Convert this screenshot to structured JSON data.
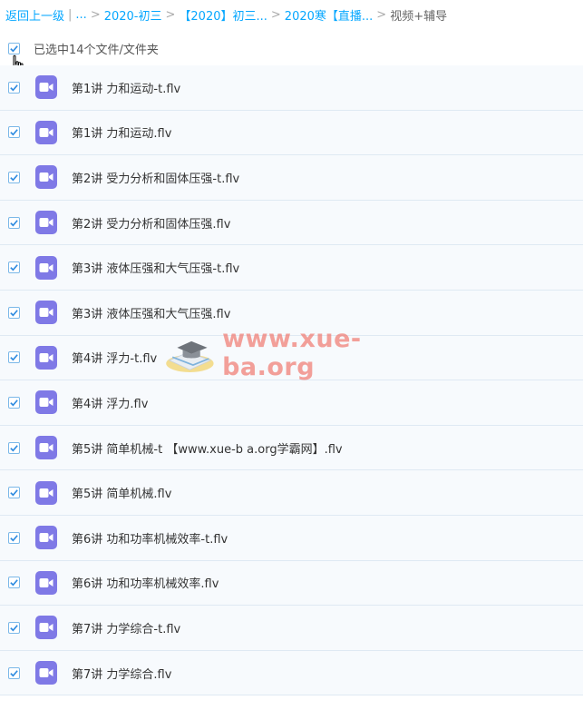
{
  "breadcrumb": {
    "back": "返回上一级",
    "ellipsis": "...",
    "items": [
      "2020-初三",
      "【2020】初三...",
      "2020寒【直播..."
    ],
    "current": "视频+辅导"
  },
  "selection": {
    "label": "已选中14个文件/文件夹"
  },
  "files": [
    {
      "name": "第1讲 力和运动-t.flv",
      "checked": true
    },
    {
      "name": "第1讲 力和运动.flv",
      "checked": true
    },
    {
      "name": "第2讲 受力分析和固体压强-t.flv",
      "checked": true
    },
    {
      "name": "第2讲 受力分析和固体压强.flv",
      "checked": true
    },
    {
      "name": "第3讲 液体压强和大气压强-t.flv",
      "checked": true
    },
    {
      "name": "第3讲 液体压强和大气压强.flv",
      "checked": true
    },
    {
      "name": "第4讲 浮力-t.flv",
      "checked": true
    },
    {
      "name": "第4讲 浮力.flv",
      "checked": true
    },
    {
      "name": "第5讲 简单机械-t 【www.xue-b a.org学霸网】.flv",
      "checked": true
    },
    {
      "name": "第5讲 简单机械.flv",
      "checked": true
    },
    {
      "name": "第6讲 功和功率机械效率-t.flv",
      "checked": true
    },
    {
      "name": "第6讲 功和功率机械效率.flv",
      "checked": true
    },
    {
      "name": "第7讲 力学综合-t.flv",
      "checked": true
    },
    {
      "name": "第7讲 力学综合.flv",
      "checked": true
    }
  ],
  "watermark": {
    "text": "www.xue-ba.org"
  },
  "colors": {
    "link": "#06a7ff",
    "check": "#2e8be0",
    "video_icon": "#7f79e6",
    "row_bg": "#f7fafd"
  }
}
